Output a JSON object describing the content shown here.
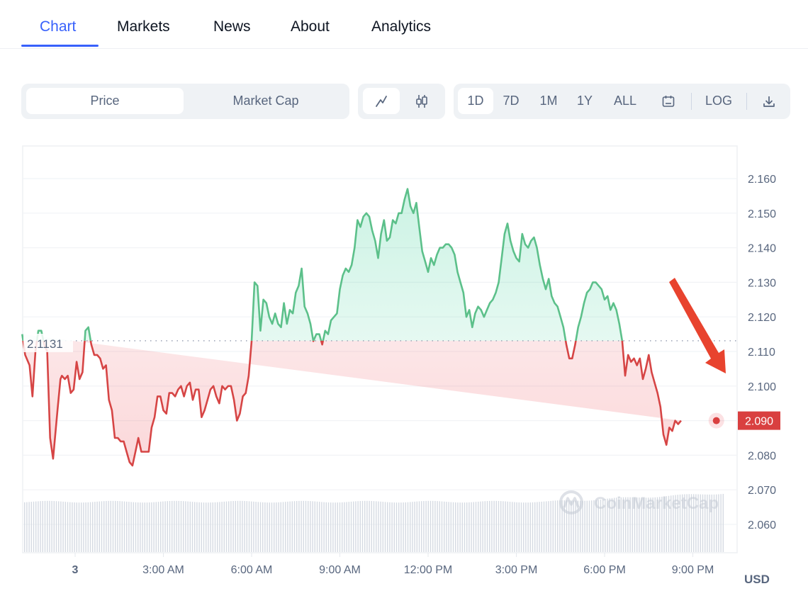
{
  "tabs": [
    {
      "label": "Chart",
      "active": true
    },
    {
      "label": "Markets",
      "active": false
    },
    {
      "label": "News",
      "active": false
    },
    {
      "label": "About",
      "active": false
    },
    {
      "label": "Analytics",
      "active": false
    }
  ],
  "toolbar": {
    "metric_tabs": [
      {
        "label": "Price",
        "active": true
      },
      {
        "label": "Market Cap",
        "active": false
      }
    ],
    "chart_type": [
      {
        "icon": "line-chart-icon",
        "active": true
      },
      {
        "icon": "candlestick-icon",
        "active": false
      }
    ],
    "ranges": [
      {
        "label": "1D",
        "active": true
      },
      {
        "label": "7D",
        "active": false
      },
      {
        "label": "1M",
        "active": false
      },
      {
        "label": "1Y",
        "active": false
      },
      {
        "label": "ALL",
        "active": false
      }
    ],
    "calendar_icon": "calendar-icon",
    "log_label": "LOG",
    "download_icon": "download-icon"
  },
  "colors": {
    "accent": "#3861fb",
    "up": "#16c784",
    "up_line": "#5cc08a",
    "down_line": "#d64545",
    "price_tag": "#d94040",
    "arrow": "#e8432e",
    "axis_text": "#58667e"
  },
  "chart_data": {
    "type": "line",
    "title": "",
    "xlabel": "",
    "ylabel": "",
    "currency_label": "USD",
    "reference_label": "2.1131",
    "reference_value": 2.1131,
    "current_value": 2.09,
    "current_label": "2.090",
    "ylim": [
      2.051,
      2.169
    ],
    "yticks": [
      2.16,
      2.15,
      2.14,
      2.13,
      2.12,
      2.11,
      2.1,
      2.09,
      2.08,
      2.07,
      2.06
    ],
    "ytick_labels": [
      "2.160",
      "2.150",
      "2.140",
      "2.130",
      "2.120",
      "2.110",
      "2.100",
      "2.090",
      "2.080",
      "2.070",
      "2.060"
    ],
    "xlim_hours": [
      -1.8,
      22.5
    ],
    "xticks_hours": [
      0,
      3,
      6,
      9,
      12,
      15,
      18,
      21
    ],
    "xtick_labels": [
      "3",
      "3:00 AM",
      "6:00 AM",
      "9:00 AM",
      "12:00 PM",
      "3:00 PM",
      "6:00 PM",
      "9:00 PM"
    ],
    "watermark": "CoinMarketCap",
    "annotation": "red arrow pointing down toward latest price",
    "series": [
      {
        "name": "Price",
        "x_hours": [
          -1.8,
          -1.7,
          -1.55,
          -1.45,
          -1.35,
          -1.25,
          -1.15,
          -1.05,
          -0.95,
          -0.85,
          -0.75,
          -0.6,
          -0.5,
          -0.45,
          -0.35,
          -0.25,
          -0.15,
          -0.05,
          0.05,
          0.15,
          0.25,
          0.35,
          0.45,
          0.55,
          0.65,
          0.75,
          0.85,
          0.95,
          1.05,
          1.15,
          1.25,
          1.35,
          1.45,
          1.55,
          1.65,
          1.75,
          1.85,
          1.95,
          2.05,
          2.15,
          2.25,
          2.4,
          2.5,
          2.6,
          2.7,
          2.8,
          2.9,
          3.0,
          3.1,
          3.2,
          3.3,
          3.4,
          3.5,
          3.6,
          3.7,
          3.8,
          3.9,
          4.0,
          4.1,
          4.2,
          4.3,
          4.4,
          4.5,
          4.6,
          4.7,
          4.8,
          4.9,
          5.0,
          5.1,
          5.2,
          5.3,
          5.4,
          5.5,
          5.6,
          5.7,
          5.8,
          5.9,
          6.0,
          6.1,
          6.2,
          6.3,
          6.4,
          6.5,
          6.6,
          6.7,
          6.8,
          6.9,
          7.0,
          7.1,
          7.2,
          7.3,
          7.4,
          7.5,
          7.6,
          7.7,
          7.8,
          7.9,
          8.0,
          8.1,
          8.2,
          8.3,
          8.4,
          8.5,
          8.6,
          8.7,
          8.8,
          8.9,
          9.0,
          9.1,
          9.2,
          9.3,
          9.4,
          9.5,
          9.6,
          9.7,
          9.8,
          9.9,
          10.0,
          10.1,
          10.2,
          10.3,
          10.4,
          10.5,
          10.6,
          10.7,
          10.8,
          10.9,
          11.0,
          11.1,
          11.2,
          11.3,
          11.4,
          11.5,
          11.6,
          11.7,
          11.8,
          11.9,
          12.0,
          12.1,
          12.2,
          12.3,
          12.4,
          12.5,
          12.6,
          12.7,
          12.8,
          12.9,
          13.0,
          13.1,
          13.2,
          13.3,
          13.4,
          13.5,
          13.6,
          13.7,
          13.8,
          13.9,
          14.0,
          14.1,
          14.2,
          14.3,
          14.4,
          14.5,
          14.6,
          14.7,
          14.8,
          14.9,
          15.0,
          15.1,
          15.2,
          15.3,
          15.4,
          15.5,
          15.6,
          15.7,
          15.8,
          15.9,
          16.0,
          16.1,
          16.2,
          16.3,
          16.4,
          16.5,
          16.6,
          16.7,
          16.8,
          16.9,
          17.0,
          17.1,
          17.2,
          17.3,
          17.4,
          17.5,
          17.6,
          17.7,
          17.8,
          17.9,
          18.0,
          18.1,
          18.2,
          18.3,
          18.4,
          18.5,
          18.6,
          18.7,
          18.8,
          18.9,
          19.0,
          19.1,
          19.2,
          19.3,
          19.4,
          19.5,
          19.6,
          19.7,
          19.8,
          19.9,
          20.0,
          20.1,
          20.2,
          20.3,
          20.4,
          20.5,
          20.6,
          20.7,
          20.8,
          20.9,
          21.0,
          21.1,
          21.2,
          21.3,
          21.4,
          21.5,
          21.6,
          21.7,
          21.8
        ],
        "values": [
          2.115,
          2.109,
          2.106,
          2.097,
          2.11,
          2.116,
          2.116,
          2.112,
          2.11,
          2.085,
          2.079,
          2.093,
          2.102,
          2.103,
          2.102,
          2.103,
          2.098,
          2.099,
          2.107,
          2.102,
          2.104,
          2.116,
          2.117,
          2.112,
          2.109,
          2.109,
          2.108,
          2.105,
          2.106,
          2.096,
          2.093,
          2.085,
          2.085,
          2.084,
          2.084,
          2.081,
          2.078,
          2.077,
          2.081,
          2.085,
          2.081,
          2.081,
          2.081,
          2.088,
          2.091,
          2.097,
          2.097,
          2.093,
          2.092,
          2.098,
          2.098,
          2.097,
          2.099,
          2.1,
          2.097,
          2.1,
          2.101,
          2.096,
          2.099,
          2.099,
          2.091,
          2.093,
          2.096,
          2.099,
          2.1,
          2.097,
          2.095,
          2.1,
          2.099,
          2.1,
          2.1,
          2.096,
          2.09,
          2.092,
          2.097,
          2.098,
          2.103,
          2.113,
          2.13,
          2.129,
          2.116,
          2.125,
          2.124,
          2.12,
          2.118,
          2.121,
          2.118,
          2.117,
          2.124,
          2.118,
          2.122,
          2.121,
          2.127,
          2.129,
          2.134,
          2.123,
          2.121,
          2.118,
          2.113,
          2.115,
          2.115,
          2.112,
          2.116,
          2.115,
          2.119,
          2.12,
          2.121,
          2.128,
          2.132,
          2.134,
          2.133,
          2.135,
          2.14,
          2.148,
          2.146,
          2.149,
          2.15,
          2.149,
          2.145,
          2.142,
          2.137,
          2.144,
          2.148,
          2.142,
          2.143,
          2.148,
          2.147,
          2.15,
          2.15,
          2.154,
          2.157,
          2.152,
          2.15,
          2.153,
          2.146,
          2.139,
          2.136,
          2.133,
          2.137,
          2.135,
          2.138,
          2.14,
          2.14,
          2.141,
          2.141,
          2.14,
          2.138,
          2.133,
          2.13,
          2.127,
          2.12,
          2.122,
          2.117,
          2.121,
          2.123,
          2.122,
          2.12,
          2.122,
          2.124,
          2.125,
          2.127,
          2.13,
          2.137,
          2.144,
          2.147,
          2.142,
          2.139,
          2.137,
          2.136,
          2.144,
          2.141,
          2.14,
          2.142,
          2.143,
          2.14,
          2.135,
          2.131,
          2.128,
          2.131,
          2.126,
          2.124,
          2.123,
          2.12,
          2.117,
          2.112,
          2.108,
          2.108,
          2.112,
          2.117,
          2.12,
          2.124,
          2.127,
          2.128,
          2.13,
          2.13,
          2.129,
          2.128,
          2.125,
          2.126,
          2.122,
          2.124,
          2.122,
          2.118,
          2.113,
          2.103,
          2.109,
          2.107,
          2.108,
          2.106,
          2.108,
          2.102,
          2.105,
          2.109,
          2.104,
          2.101,
          2.098,
          2.094,
          2.086,
          2.083,
          2.088,
          2.087,
          2.09,
          2.089,
          2.09
        ]
      }
    ],
    "volume_bars": "uniform light-gray volume histogram, slightly rising toward the end"
  }
}
